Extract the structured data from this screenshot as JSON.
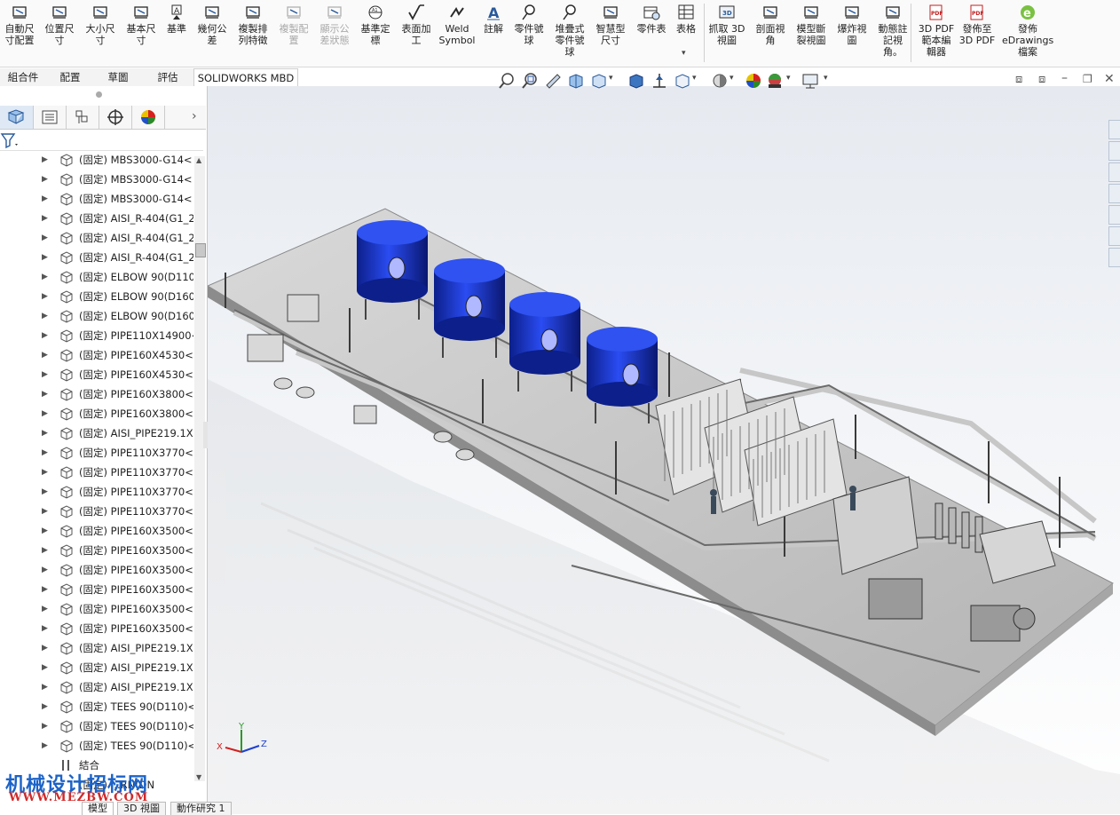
{
  "ribbon": {
    "buttons": [
      {
        "id": "auto-dim",
        "label": "自動尺\n寸配置",
        "icon": "auto-dimension-icon",
        "disabled": false
      },
      {
        "id": "location-dim",
        "label": "位置尺\n寸",
        "icon": "location-dimension-icon",
        "disabled": false
      },
      {
        "id": "size-dim",
        "label": "大小尺\n寸",
        "icon": "size-dimension-icon",
        "disabled": false
      },
      {
        "id": "basic-dim",
        "label": "基本尺\n寸",
        "icon": "basic-dimension-icon",
        "disabled": false
      },
      {
        "id": "datum",
        "label": "基準",
        "icon": "datum-icon",
        "disabled": false
      },
      {
        "id": "geo-tol",
        "label": "幾何公\n差",
        "icon": "geometric-tolerance-icon",
        "disabled": false
      },
      {
        "id": "copy-feature",
        "label": "複製排\n列特徵",
        "icon": "pattern-feature-icon",
        "disabled": false
      },
      {
        "id": "copy-scheme",
        "label": "複製配\n置",
        "icon": "copy-scheme-icon",
        "disabled": true
      },
      {
        "id": "show-tol",
        "label": "顯示公\n差狀態",
        "icon": "tolerance-status-icon",
        "disabled": true
      },
      {
        "id": "datum-target",
        "label": "基準定\n標",
        "icon": "datum-target-icon",
        "disabled": false
      },
      {
        "id": "surface-finish",
        "label": "表面加\n工",
        "icon": "surface-finish-icon",
        "disabled": false
      },
      {
        "id": "weld",
        "label": "Weld\nSymbol",
        "icon": "weld-symbol-icon",
        "disabled": false
      },
      {
        "id": "note",
        "label": "註解",
        "icon": "note-icon",
        "disabled": false
      },
      {
        "id": "balloon",
        "label": "零件號\n球",
        "icon": "balloon-icon",
        "disabled": false
      },
      {
        "id": "stacked-balloon",
        "label": "堆疊式\n零件號\n球",
        "icon": "stacked-balloon-icon",
        "disabled": false
      },
      {
        "id": "smart-dim",
        "label": "智慧型\n尺寸",
        "icon": "smart-dimension-icon",
        "disabled": false
      },
      {
        "id": "bom",
        "label": "零件表",
        "icon": "bom-icon",
        "disabled": false
      },
      {
        "id": "table",
        "label": "表格",
        "icon": "table-icon",
        "disabled": false
      },
      {
        "id": "capture-3d",
        "label": "抓取 3D\n視圖",
        "icon": "capture-3d-view-icon",
        "disabled": false
      },
      {
        "id": "section-view",
        "label": "剖面視\n角",
        "icon": "section-view-icon",
        "disabled": false
      },
      {
        "id": "model-break",
        "label": "模型斷\n裂視圖",
        "icon": "model-break-icon",
        "disabled": false
      },
      {
        "id": "explode",
        "label": "爆炸視\n圖",
        "icon": "explode-view-icon",
        "disabled": false
      },
      {
        "id": "dynamic-annot",
        "label": "動態註\n記視\n角。",
        "icon": "dynamic-annotation-icon",
        "disabled": false
      },
      {
        "id": "pdf-template",
        "label": "3D PDF\n範本編\n輯器",
        "icon": "pdf-template-icon",
        "disabled": false
      },
      {
        "id": "publish-pdf",
        "label": "發佈至\n3D PDF",
        "icon": "publish-pdf-icon",
        "disabled": false
      },
      {
        "id": "publish-edrw",
        "label": "發佈\neDrawings\n檔案",
        "icon": "edrawings-icon",
        "disabled": false
      }
    ]
  },
  "tabs": [
    "組合件",
    "配置",
    "草圖",
    "評估",
    "SOLIDWORKS MBD"
  ],
  "tree": {
    "items": [
      "(固定) MBS3000-G14<",
      "(固定) MBS3000-G14<",
      "(固定) MBS3000-G14<",
      "(固定) AISI_R-404(G1_2",
      "(固定) AISI_R-404(G1_2",
      "(固定) AISI_R-404(G1_2",
      "(固定) ELBOW 90(D110",
      "(固定) ELBOW 90(D160",
      "(固定) ELBOW 90(D160",
      "(固定) PIPE110X14900<",
      "(固定) PIPE160X4530<1",
      "(固定) PIPE160X4530<2",
      "(固定) PIPE160X3800<1",
      "(固定) PIPE160X3800<2",
      "(固定) AISI_PIPE219.1X2",
      "(固定) PIPE110X3770<1",
      "(固定) PIPE110X3770<2",
      "(固定) PIPE110X3770<3",
      "(固定) PIPE110X3770<4",
      "(固定) PIPE160X3500<1",
      "(固定) PIPE160X3500<2",
      "(固定) PIPE160X3500<3",
      "(固定) PIPE160X3500<4",
      "(固定) PIPE160X3500<5",
      "(固定) PIPE160X3500<6",
      "(固定) AISI_PIPE219.1X2",
      "(固定) AISI_PIPE219.1X2",
      "(固定) AISI_PIPE219.1X2",
      "(固定) TEES 90(D110)<",
      "(固定) TEES 90(D110)<",
      "(固定) TEES 90(D110)<"
    ],
    "mates_label": "結合",
    "last_item": "(固定) ...RN(DN"
  },
  "bottom_tabs": [
    "模型",
    "3D 視圖",
    "動作研究 1"
  ],
  "watermark": {
    "line1": "机械设计招标网",
    "line2": "WWW.MEZBW.COM"
  },
  "triad": {
    "x": "X",
    "y": "Y",
    "z": "Z"
  },
  "colors": {
    "vessel": "#1a3ad8",
    "frame": "#8a8a8a",
    "platform": "#c8c8c8"
  }
}
